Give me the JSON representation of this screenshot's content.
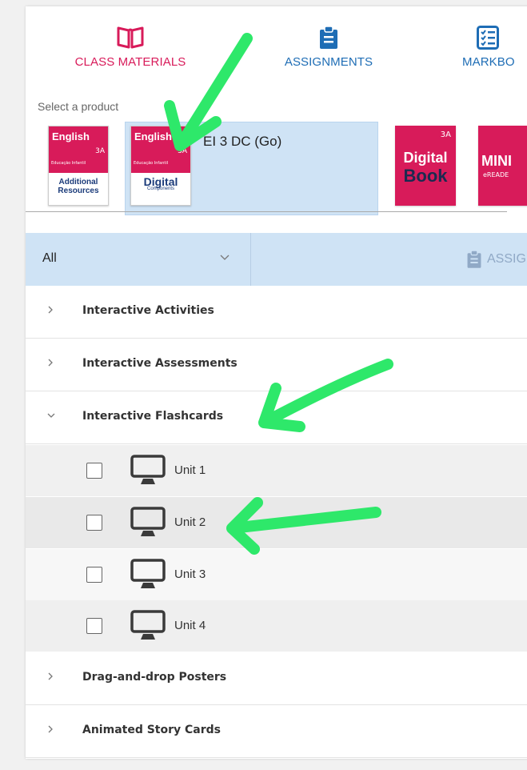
{
  "nav": {
    "class_materials": "CLASS MATERIALS",
    "assignments": "ASSIGNMENTS",
    "markbook": "MARKBO"
  },
  "select_label": "Select a product",
  "products": {
    "additional": {
      "brand": "English",
      "grade": "3A",
      "sub": "Educação Infantil",
      "line1": "Additional",
      "line2": "Resources"
    },
    "digital": {
      "brand": "English",
      "grade": "3A",
      "sub": "Educação Infantil",
      "line1": "Digital",
      "line2": "Components"
    },
    "selected_title": "EI 3 DC (Go)",
    "digibook": {
      "grade": "3A",
      "line1": "Digital",
      "line2": "Book"
    },
    "mini": {
      "line1": "MINI",
      "line2": "eREADE"
    }
  },
  "filter": {
    "value": "All",
    "assign_label": "ASSIG"
  },
  "categories": [
    {
      "label": "Interactive Activities",
      "expanded": false
    },
    {
      "label": "Interactive Assessments",
      "expanded": false
    },
    {
      "label": "Interactive Flashcards",
      "expanded": true
    },
    {
      "label": "Drag-and-drop Posters",
      "expanded": false
    },
    {
      "label": "Animated Story Cards",
      "expanded": false
    }
  ],
  "units": [
    {
      "label": "Unit 1",
      "checked": false
    },
    {
      "label": "Unit 2",
      "checked": false
    },
    {
      "label": "Unit 3",
      "checked": false
    },
    {
      "label": "Unit 4",
      "checked": false
    }
  ],
  "colors": {
    "accent_pink": "#d81b5a",
    "accent_blue": "#1e6db5",
    "selected_bg": "#cfe3f5",
    "annotation_green": "#2ee86a"
  }
}
